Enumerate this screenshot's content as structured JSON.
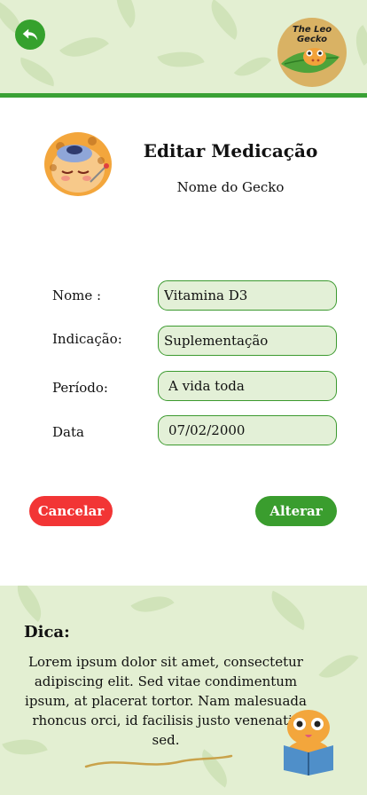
{
  "header": {
    "back_icon": "back-arrow-icon",
    "logo_text_line1": "The Leo",
    "logo_text_line2": "Gecko"
  },
  "page": {
    "title": "Editar Medicação",
    "subtitle": "Nome do Gecko"
  },
  "form": {
    "name_label": "Nome :",
    "name_value": "Vitamina D3",
    "indication_label": "Indicação:",
    "indication_value": "Suplementação",
    "period_label": "Período:",
    "period_value": "A vida toda",
    "date_label": "Data",
    "date_value": "07/02/2000"
  },
  "actions": {
    "cancel_label": "Cancelar",
    "save_label": "Alterar"
  },
  "tip": {
    "title": "Dica:",
    "text": "Lorem ipsum dolor sit amet, consectetur adipiscing elit. Sed vitae condimentum ipsum, at placerat tortor. Nam malesuada rhoncus orci, id facilisis justo venenatis sed."
  },
  "colors": {
    "primary_green": "#3a9d2e",
    "cancel_red": "#f23535",
    "field_bg": "#e3f0d7",
    "panel_bg": "#e3efd2"
  }
}
